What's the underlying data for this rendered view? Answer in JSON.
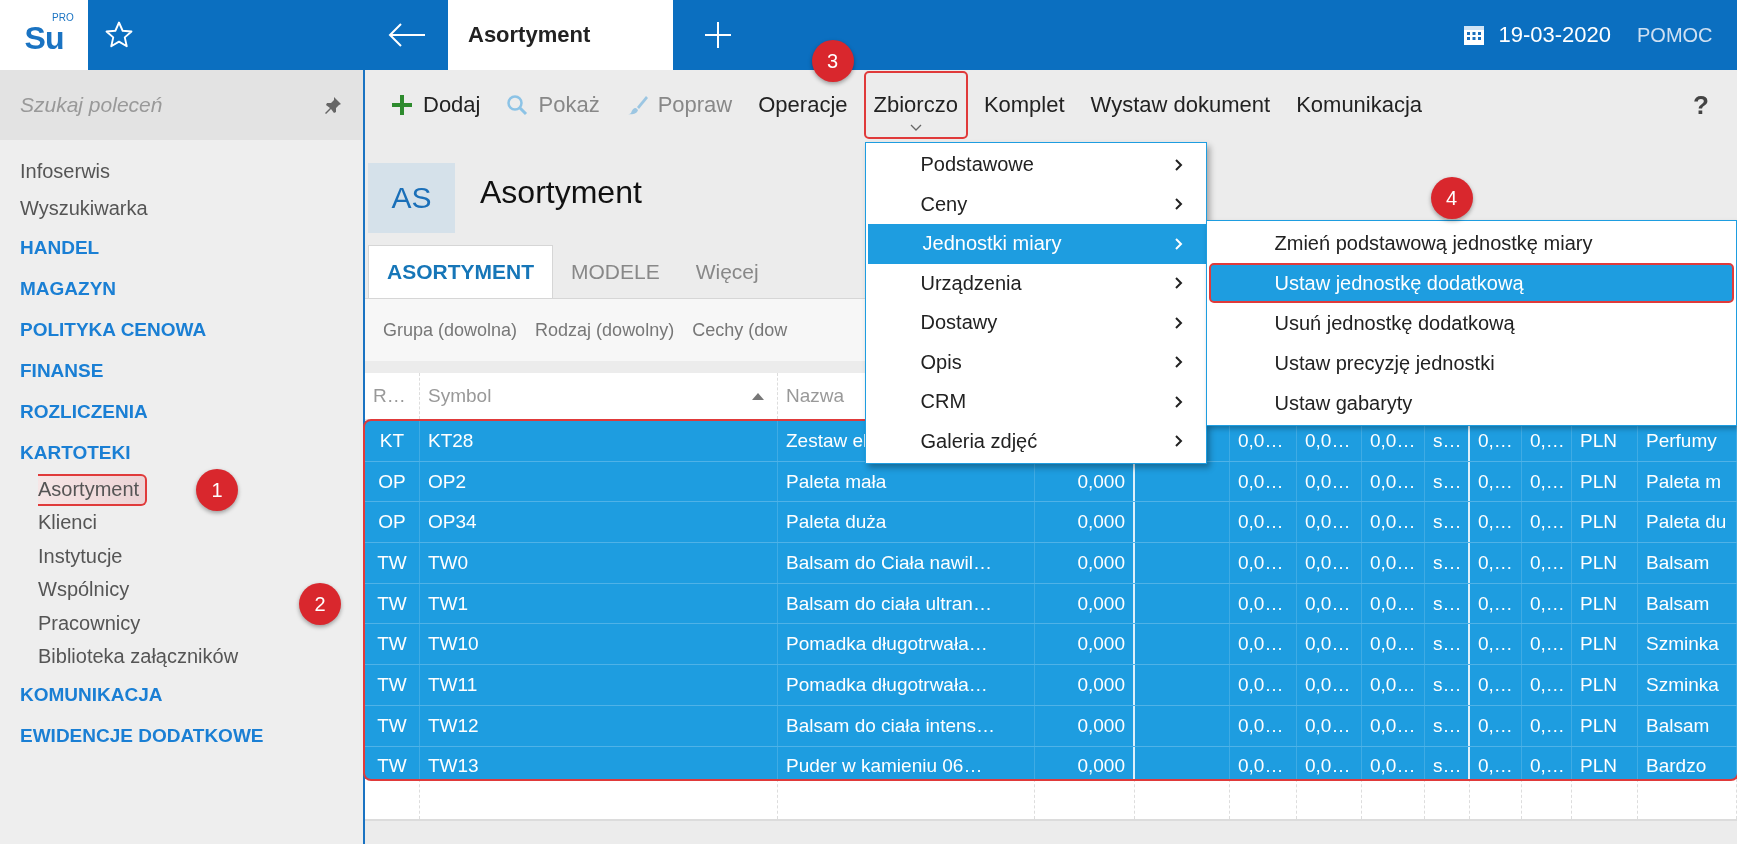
{
  "app": {
    "logo": "Su",
    "logo_badge": "PRO"
  },
  "top_bar": {
    "tabs": [
      {
        "label": "Asortyment",
        "selected": true
      }
    ],
    "date": "19-03-2020",
    "help": "POMOC"
  },
  "sidebar": {
    "search": {
      "placeholder": "Szukaj poleceń"
    },
    "items": [
      {
        "label": "Infoserwis",
        "kind": "link"
      },
      {
        "label": "Wyszukiwarka",
        "kind": "link"
      },
      {
        "label": "HANDEL",
        "kind": "section"
      },
      {
        "label": "MAGAZYN",
        "kind": "section"
      },
      {
        "label": "POLITYKA CENOWA",
        "kind": "section"
      },
      {
        "label": "FINANSE",
        "kind": "section"
      },
      {
        "label": "ROZLICZENIA",
        "kind": "section"
      },
      {
        "label": "KARTOTEKI",
        "kind": "section",
        "children": [
          {
            "label": "Asortyment",
            "selected": true,
            "callout": "1"
          },
          {
            "label": "Klienci",
            "selected": false
          },
          {
            "label": "Instytucje",
            "selected": false
          },
          {
            "label": "Wspólnicy",
            "selected": false
          },
          {
            "label": "Pracownicy",
            "selected": false
          },
          {
            "label": "Biblioteka załączników",
            "selected": false
          }
        ]
      },
      {
        "label": "KOMUNIKACJA",
        "kind": "section"
      },
      {
        "label": "EWIDENCJE DODATKOWE",
        "kind": "section"
      }
    ]
  },
  "toolbar": {
    "items": [
      {
        "label": "Dodaj",
        "disabled": false
      },
      {
        "label": "Pokaż",
        "disabled": true
      },
      {
        "label": "Popraw",
        "disabled": true
      },
      {
        "label": "Operacje",
        "disabled": false
      },
      {
        "label": "Zbiorczo",
        "disabled": false,
        "expanded": true,
        "callout": "3",
        "menu": [
          {
            "label": "Podstawowe",
            "selected": false
          },
          {
            "label": "Ceny",
            "selected": false
          },
          {
            "label": "Jednostki miary",
            "selected": true,
            "children": [
              {
                "label": "Zmień podstawową jednostkę miary",
                "selected": false
              },
              {
                "label": "Ustaw jednostkę dodatkową",
                "selected": true,
                "callout": "4"
              },
              {
                "label": "Usuń jednostkę dodatkową",
                "selected": false
              },
              {
                "label": "Ustaw precyzję jednostki",
                "selected": false
              },
              {
                "label": "Ustaw gabaryty",
                "selected": false
              }
            ]
          },
          {
            "label": "Urządzenia",
            "selected": false
          },
          {
            "label": "Dostawy",
            "selected": false
          },
          {
            "label": "Opis",
            "selected": false
          },
          {
            "label": "CRM",
            "selected": false
          },
          {
            "label": "Galeria zdjęć",
            "selected": false
          }
        ]
      },
      {
        "label": "Komplet",
        "disabled": false
      },
      {
        "label": "Wystaw dokument",
        "disabled": false
      },
      {
        "label": "Komunikacja",
        "disabled": false
      }
    ],
    "help": "?"
  },
  "module": {
    "badge": "AS",
    "title": "Asortyment"
  },
  "tabs": [
    {
      "label": "ASORTYMENT",
      "selected": true
    },
    {
      "label": "MODELE",
      "selected": false
    },
    {
      "label": "Więcej",
      "selected": false
    }
  ],
  "filters": [
    "Grupa (dowolna)",
    "Rodzaj (dowolny)",
    "Cechy (dow"
  ],
  "table": {
    "callout": "2",
    "columns": [
      {
        "label": "R…"
      },
      {
        "label": "Symbol",
        "sort_ascending": true
      },
      {
        "label": "Nazwa"
      }
    ],
    "rows": [
      {
        "selected": true,
        "type": "KT",
        "symbol": "KT28",
        "name": "Zestaw el",
        "values": [
          "0,0…",
          "0,0…",
          "0,0…",
          "s…",
          "0,…",
          "0,…"
        ],
        "currency": "PLN",
        "description": "Perfumy"
      },
      {
        "selected": true,
        "type": "OP",
        "symbol": "OP2",
        "name": "Paleta mała",
        "qty": "0,000",
        "values": [
          "0,0…",
          "0,0…",
          "0,0…",
          "s…",
          "0,…",
          "0,…"
        ],
        "currency": "PLN",
        "description": "Paleta m"
      },
      {
        "selected": true,
        "type": "OP",
        "symbol": "OP34",
        "name": "Paleta duża",
        "qty": "0,000",
        "values": [
          "0,0…",
          "0,0…",
          "0,0…",
          "s…",
          "0,…",
          "0,…"
        ],
        "currency": "PLN",
        "description": "Paleta du"
      },
      {
        "selected": true,
        "type": "TW",
        "symbol": "TW0",
        "name": "Balsam do Ciała nawil…",
        "qty": "0,000",
        "values": [
          "0,0…",
          "0,0…",
          "0,0…",
          "s…",
          "0,…",
          "0,…"
        ],
        "currency": "PLN",
        "description": "Balsam"
      },
      {
        "selected": true,
        "type": "TW",
        "symbol": "TW1",
        "name": "Balsam do ciała ultran…",
        "qty": "0,000",
        "values": [
          "0,0…",
          "0,0…",
          "0,0…",
          "s…",
          "0,…",
          "0,…"
        ],
        "currency": "PLN",
        "description": "Balsam"
      },
      {
        "selected": true,
        "type": "TW",
        "symbol": "TW10",
        "name": "Pomadka długotrwała…",
        "qty": "0,000",
        "values": [
          "0,0…",
          "0,0…",
          "0,0…",
          "s…",
          "0,…",
          "0,…"
        ],
        "currency": "PLN",
        "description": "Szminka"
      },
      {
        "selected": true,
        "type": "TW",
        "symbol": "TW11",
        "name": "Pomadka długotrwała…",
        "qty": "0,000",
        "values": [
          "0,0…",
          "0,0…",
          "0,0…",
          "s…",
          "0,…",
          "0,…"
        ],
        "currency": "PLN",
        "description": "Szminka"
      },
      {
        "selected": true,
        "type": "TW",
        "symbol": "TW12",
        "name": "Balsam do ciała intens…",
        "qty": "0,000",
        "values": [
          "0,0…",
          "0,0…",
          "0,0…",
          "s…",
          "0,…",
          "0,…"
        ],
        "currency": "PLN",
        "description": "Balsam"
      },
      {
        "selected": true,
        "type": "TW",
        "symbol": "TW13",
        "name": "Puder w kamieniu 06…",
        "qty": "0,000",
        "values": [
          "0,0…",
          "0,0…",
          "0,0…",
          "s…",
          "0,…",
          "0,…"
        ],
        "currency": "PLN",
        "description": "Bardzo"
      }
    ]
  }
}
